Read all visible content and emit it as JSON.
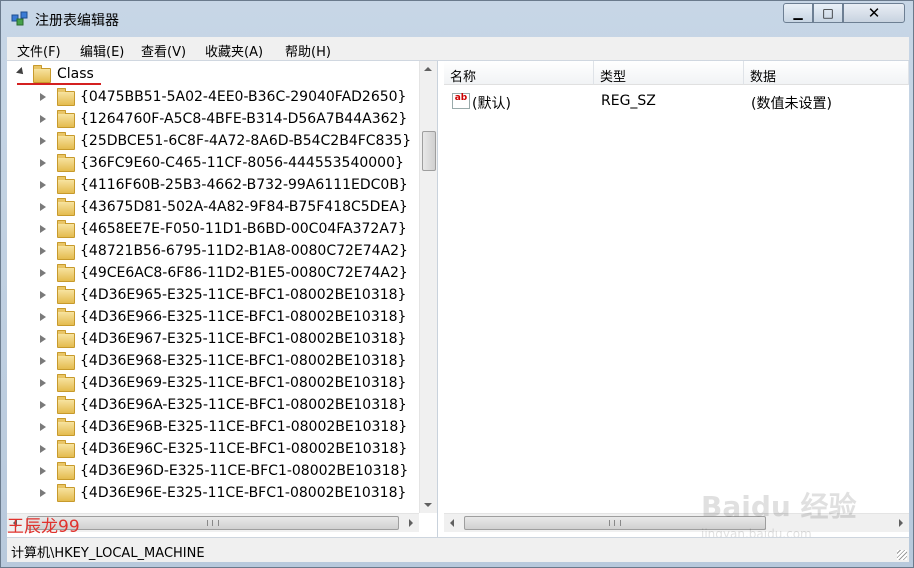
{
  "window": {
    "title": "注册表编辑器"
  },
  "menu": [
    "文件(F)",
    "编辑(E)",
    "查看(V)",
    "收藏夹(A)",
    "帮助(H)"
  ],
  "tree": {
    "root_label": "Class",
    "items": [
      "{0475BB51-5A02-4EE0-B36C-29040FAD2650}",
      "{1264760F-A5C8-4BFE-B314-D56A7B44A362}",
      "{25DBCE51-6C8F-4A72-8A6D-B54C2B4FC835}",
      "{36FC9E60-C465-11CF-8056-444553540000}",
      "{4116F60B-25B3-4662-B732-99A6111EDC0B}",
      "{43675D81-502A-4A82-9F84-B75F418C5DEA}",
      "{4658EE7E-F050-11D1-B6BD-00C04FA372A7}",
      "{48721B56-6795-11D2-B1A8-0080C72E74A2}",
      "{49CE6AC8-6F86-11D2-B1E5-0080C72E74A2}",
      "{4D36E965-E325-11CE-BFC1-08002BE10318}",
      "{4D36E966-E325-11CE-BFC1-08002BE10318}",
      "{4D36E967-E325-11CE-BFC1-08002BE10318}",
      "{4D36E968-E325-11CE-BFC1-08002BE10318}",
      "{4D36E969-E325-11CE-BFC1-08002BE10318}",
      "{4D36E96A-E325-11CE-BFC1-08002BE10318}",
      "{4D36E96B-E325-11CE-BFC1-08002BE10318}",
      "{4D36E96C-E325-11CE-BFC1-08002BE10318}",
      "{4D36E96D-E325-11CE-BFC1-08002BE10318}",
      "{4D36E96E-E325-11CE-BFC1-08002BE10318}"
    ]
  },
  "list": {
    "columns": [
      "名称",
      "类型",
      "数据"
    ],
    "rows": [
      {
        "name": "(默认)",
        "type": "REG_SZ",
        "data": "(数值未设置)"
      }
    ]
  },
  "status": {
    "path": "计算机\\HKEY_LOCAL_MACHINE"
  },
  "watermark": {
    "author": "王辰龙99",
    "brand": "Baidu 经验",
    "site": "jingyan.baidu.com"
  }
}
